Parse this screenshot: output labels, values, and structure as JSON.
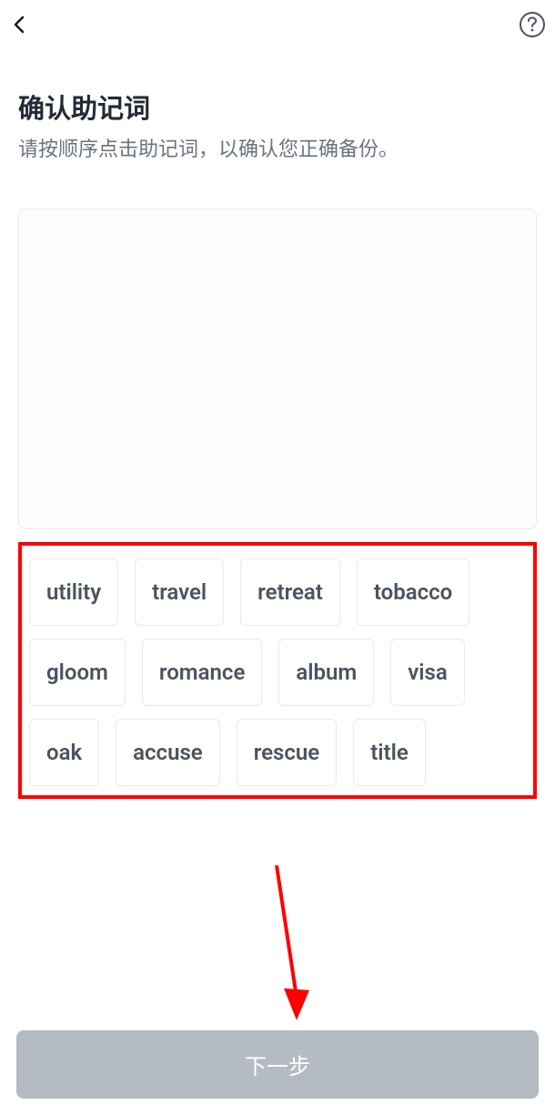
{
  "header": {
    "back_icon": "chevron-left",
    "help_icon": "question-circle"
  },
  "main": {
    "title": "确认助记词",
    "subtitle": "请按顺序点击助记词，以确认您正确备份。"
  },
  "words": {
    "row1": [
      "utility",
      "travel",
      "retreat",
      "tobacco"
    ],
    "row2": [
      "gloom",
      "romance",
      "album",
      "visa"
    ],
    "row3": [
      "oak",
      "accuse",
      "rescue",
      "title"
    ]
  },
  "button": {
    "next_label": "下一步"
  },
  "annotation": {
    "highlight_color": "#ff0000",
    "arrow_color": "#ff0000"
  }
}
